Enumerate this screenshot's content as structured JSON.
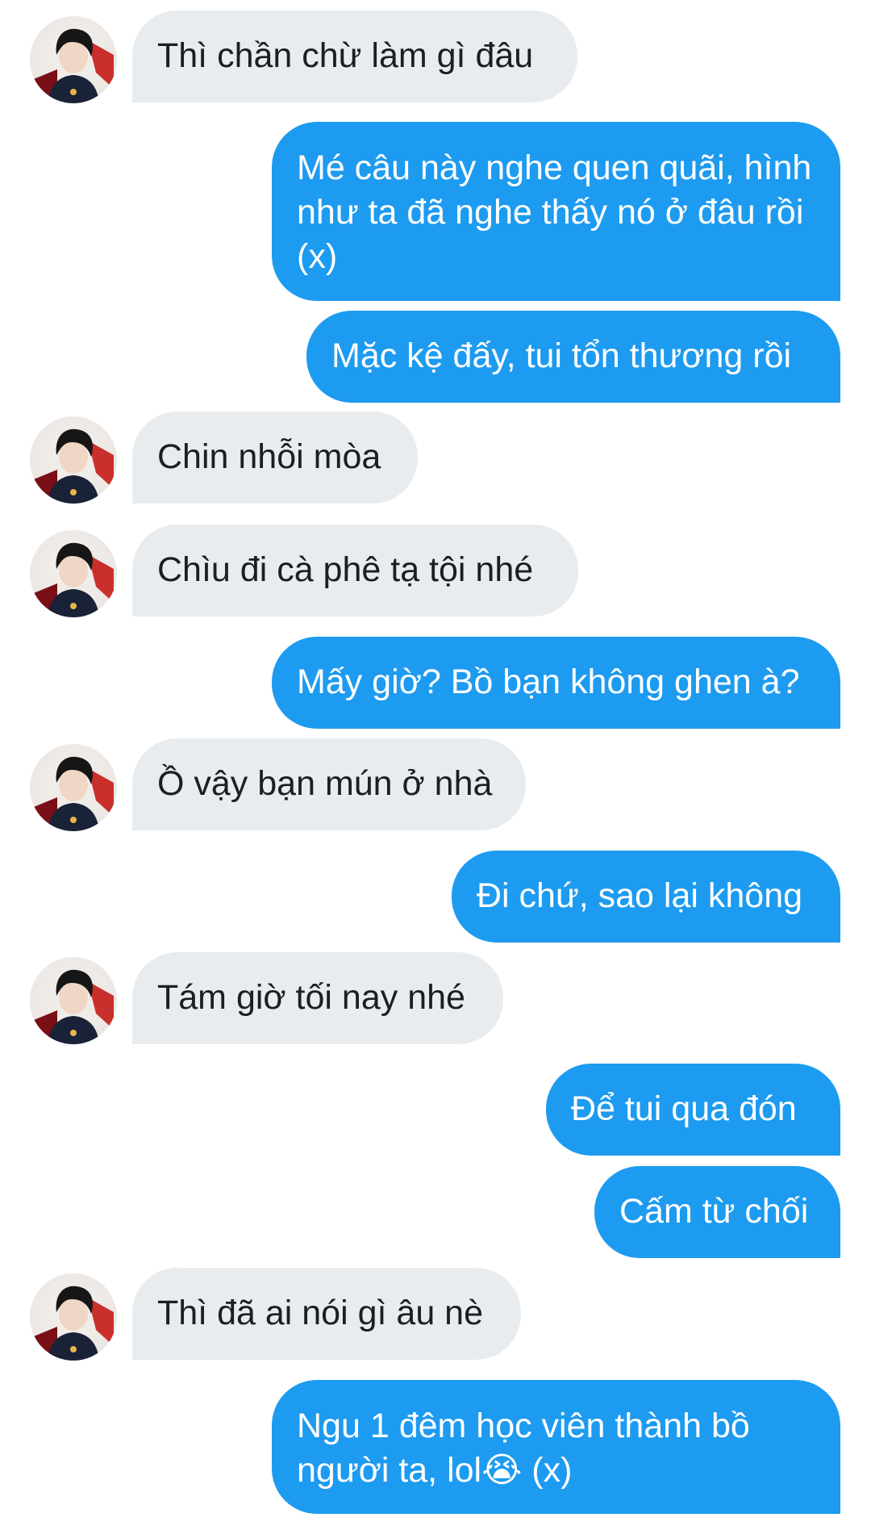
{
  "conversation": {
    "messages": [
      {
        "from": "them",
        "text": "Thì chần chừ làm gì đâu"
      },
      {
        "from": "me",
        "text": "Mé câu này nghe quen quãi, hình như ta đã nghe thấy nó ở đâu rồi (x)"
      },
      {
        "from": "me",
        "text": "Mặc kệ đấy, tui tổn thương rồi"
      },
      {
        "from": "them",
        "text": "Chin nhỗi mòa"
      },
      {
        "from": "them",
        "text": "Chìu đi cà phê tạ tội nhé"
      },
      {
        "from": "me",
        "text": "Mấy giờ? Bồ bạn không ghen à?"
      },
      {
        "from": "them",
        "text": "Ồ vậy bạn mún ở nhà"
      },
      {
        "from": "me",
        "text": "Đi chứ, sao lại không"
      },
      {
        "from": "them",
        "text": "Tám giờ tối nay nhé"
      },
      {
        "from": "me",
        "text": "Để tui qua đón"
      },
      {
        "from": "me",
        "text": "Cấm từ chối"
      },
      {
        "from": "them",
        "text": "Thì đã ai nói gì âu nè"
      },
      {
        "from": "me",
        "text": "Ngu 1 đêm học viên thành bồ người ta, lol😭 (x)"
      }
    ]
  },
  "colors": {
    "incoming_bubble": "#e8ecef",
    "outgoing_bubble": "#1d9bf0",
    "incoming_text": "#1b1f23",
    "outgoing_text": "#ffffff"
  },
  "icons": {
    "avatar": "user-avatar-photo"
  }
}
